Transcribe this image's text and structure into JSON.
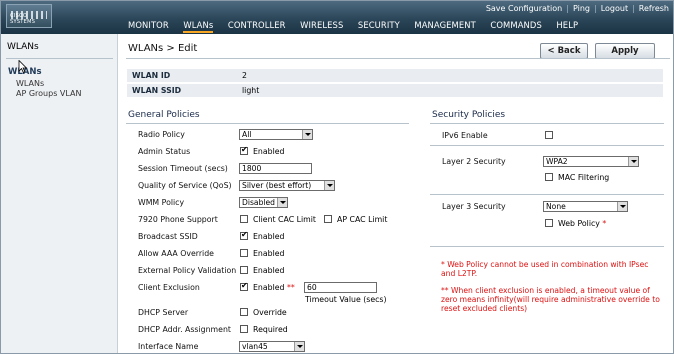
{
  "header": {
    "logo_text": "CISCO SYSTEMS",
    "top_links": [
      "Save Configuration",
      "Ping",
      "Logout",
      "Refresh"
    ],
    "nav": [
      "MONITOR",
      "WLANs",
      "CONTROLLER",
      "WIRELESS",
      "SECURITY",
      "MANAGEMENT",
      "COMMANDS",
      "HELP"
    ],
    "active_nav": "WLANs"
  },
  "sidebar": {
    "title": "WLANs",
    "selected": "WLANs",
    "items": [
      "WLANs",
      "AP Groups VLAN"
    ]
  },
  "page": {
    "title": "WLANs > Edit",
    "back_label": "< Back",
    "apply_label": "Apply"
  },
  "wlan": {
    "id_label": "WLAN ID",
    "id_value": "2",
    "ssid_label": "WLAN SSID",
    "ssid_value": "light"
  },
  "general": {
    "title": "General Policies",
    "radio_policy_label": "Radio Policy",
    "radio_policy_value": "All",
    "admin_status_label": "Admin Status",
    "enabled_text": "Enabled",
    "session_timeout_label": "Session Timeout (secs)",
    "session_timeout_value": "1800",
    "qos_label": "Quality of Service (QoS)",
    "qos_value": "Silver (best effort)",
    "wmm_label": "WMM Policy",
    "wmm_value": "Disabled",
    "phone_label": "7920 Phone Support",
    "client_cac_text": "Client CAC Limit",
    "ap_cac_text": "AP CAC Limit",
    "broadcast_ssid_label": "Broadcast SSID",
    "allow_aaa_label": "Allow AAA Override",
    "ext_policy_label": "External Policy Validation",
    "client_excl_label": "Client Exclusion",
    "client_excl_stars": "**",
    "timeout_value": "60",
    "timeout_caption": "Timeout Value (secs)",
    "dhcp_server_label": "DHCP Server",
    "override_text": "Override",
    "dhcp_addr_label": "DHCP Addr. Assignment",
    "required_text": "Required",
    "interface_label": "Interface Name",
    "interface_value": "vlan45"
  },
  "security": {
    "title": "Security Policies",
    "ipv6_label": "IPv6 Enable",
    "l2_label": "Layer 2 Security",
    "l2_value": "WPA2",
    "mac_filter_text": "MAC Filtering",
    "l3_label": "Layer 3 Security",
    "l3_value": "None",
    "web_policy_text": "Web Policy",
    "web_policy_star": "*"
  },
  "notes": {
    "note1_l1": "* Web Policy cannot be used in combination with IPsec",
    "note1_l2": "and L2TP.",
    "note2_l1": "** When client exclusion is enabled, a timeout value of",
    "note2_l2": "zero means infinity(will require administrative override to",
    "note2_l3": "reset excluded clients)"
  },
  "checks": {
    "admin_status": true,
    "client_cac": false,
    "ap_cac": false,
    "broadcast_ssid": true,
    "allow_aaa": false,
    "ext_policy": false,
    "client_exclusion": true,
    "dhcp_override": false,
    "dhcp_required": false,
    "ipv6": false,
    "mac_filtering": false,
    "web_policy": false
  }
}
